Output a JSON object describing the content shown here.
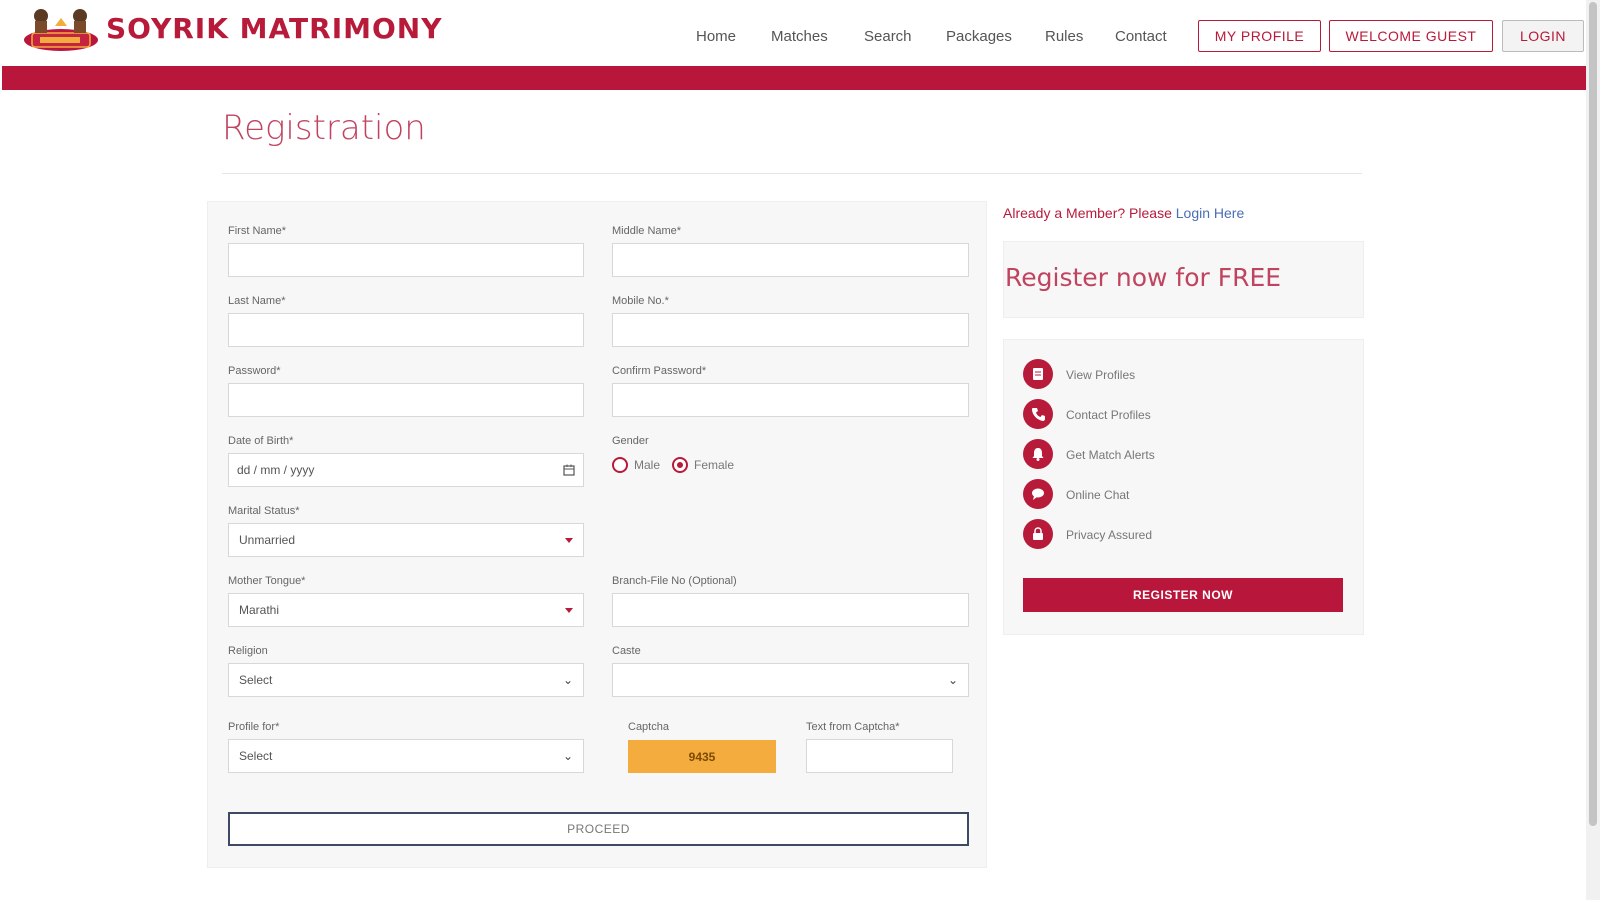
{
  "brand": {
    "name": "SOYRIK MATRIMONY"
  },
  "nav": {
    "links": [
      "Home",
      "Matches",
      "Search",
      "Packages",
      "Rules",
      "Contact"
    ],
    "my_profile": "MY PROFILE",
    "welcome": "WELCOME GUEST",
    "login": "LOGIN"
  },
  "page": {
    "title": "Registration"
  },
  "form": {
    "first_name_label": "First Name*",
    "middle_name_label": "Middle Name*",
    "last_name_label": "Last Name*",
    "mobile_label": "Mobile No.*",
    "password_label": "Password*",
    "confirm_password_label": "Confirm Password*",
    "dob_label": "Date of Birth*",
    "dob_placeholder": "dd / mm / yyyy",
    "gender_label": "Gender",
    "gender_options": [
      "Male",
      "Female"
    ],
    "gender_selected": "Female",
    "marital_label": "Marital Status*",
    "marital_value": "Unmarried",
    "tongue_label": "Mother Tongue*",
    "tongue_value": "Marathi",
    "branch_label": "Branch-File No (Optional)",
    "religion_label": "Religion",
    "religion_value": "Select",
    "caste_label": "Caste",
    "caste_value": "",
    "profile_for_label": "Profile for*",
    "profile_for_value": "Select",
    "captcha_label": "Captcha",
    "captcha_value": "9435",
    "captcha_text_label": "Text from Captcha*",
    "proceed": "PROCEED"
  },
  "sidebar": {
    "member_text": "Already a Member? Please",
    "member_link": "Login Here",
    "free_title": "Register now for FREE",
    "features": [
      "View Profiles",
      "Contact Profiles",
      "Get Match Alerts",
      "Online Chat",
      "Privacy Assured"
    ],
    "register_button": "REGISTER NOW"
  },
  "colors": {
    "brand_red": "#b8173b",
    "captcha_orange": "#f5ac3e",
    "link_blue": "#4a6db5"
  }
}
